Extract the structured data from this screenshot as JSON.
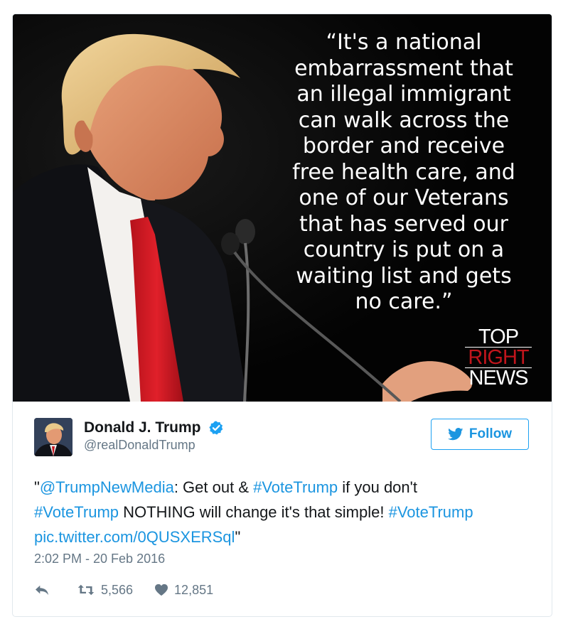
{
  "media": {
    "quote": "“It's a national embarrassment that an illegal immigrant can walk across the border and receive free health care, and one of our Veterans that has served our country is put on a waiting list and gets no care.”",
    "quote_lines": [
      "“It's a national",
      "embarrassment that",
      "an illegal immigrant",
      "can walk across the",
      "border and receive",
      "free health care, and",
      "one of our Veterans",
      "that has served our",
      "country is put on a",
      "waiting list and gets",
      "no care.”"
    ],
    "brand_line1": "TOP",
    "brand_line2": "RIGHT",
    "brand_line3": "NEWS",
    "brand_accent_color": "#c0151c"
  },
  "author": {
    "display_name": "Donald J. Trump",
    "handle": "@realDonaldTrump",
    "verified": true,
    "avatar_icon": "profile-photo"
  },
  "follow": {
    "label": "Follow",
    "icon": "twitter-bird-icon",
    "color": "#1b95e0"
  },
  "tweet": {
    "segments": [
      {
        "text": "\"",
        "link": false
      },
      {
        "text": "@TrumpNewMedia",
        "link": true
      },
      {
        "text": ": Get out & ",
        "link": false
      },
      {
        "text": "#VoteTrump",
        "link": true
      },
      {
        "text": " if you don't ",
        "link": false
      },
      {
        "text": "#VoteTrump",
        "link": true
      },
      {
        "text": " NOTHING will change it's that simple! ",
        "link": false
      },
      {
        "text": "#VoteTrump",
        "link": true
      },
      {
        "text": " ",
        "link": false
      },
      {
        "text": "pic.twitter.com/0QUSXERSql",
        "link": true
      },
      {
        "text": "\"",
        "link": false
      }
    ],
    "timestamp": "2:02 PM - 20 Feb 2016"
  },
  "actions": {
    "reply_icon": "reply-icon",
    "retweet_icon": "retweet-icon",
    "retweet_count": "5,566",
    "like_icon": "heart-icon",
    "like_count": "12,851"
  },
  "colors": {
    "link": "#1b95e0",
    "text": "#14171a",
    "muted": "#657786",
    "border": "#e1e8ed"
  }
}
